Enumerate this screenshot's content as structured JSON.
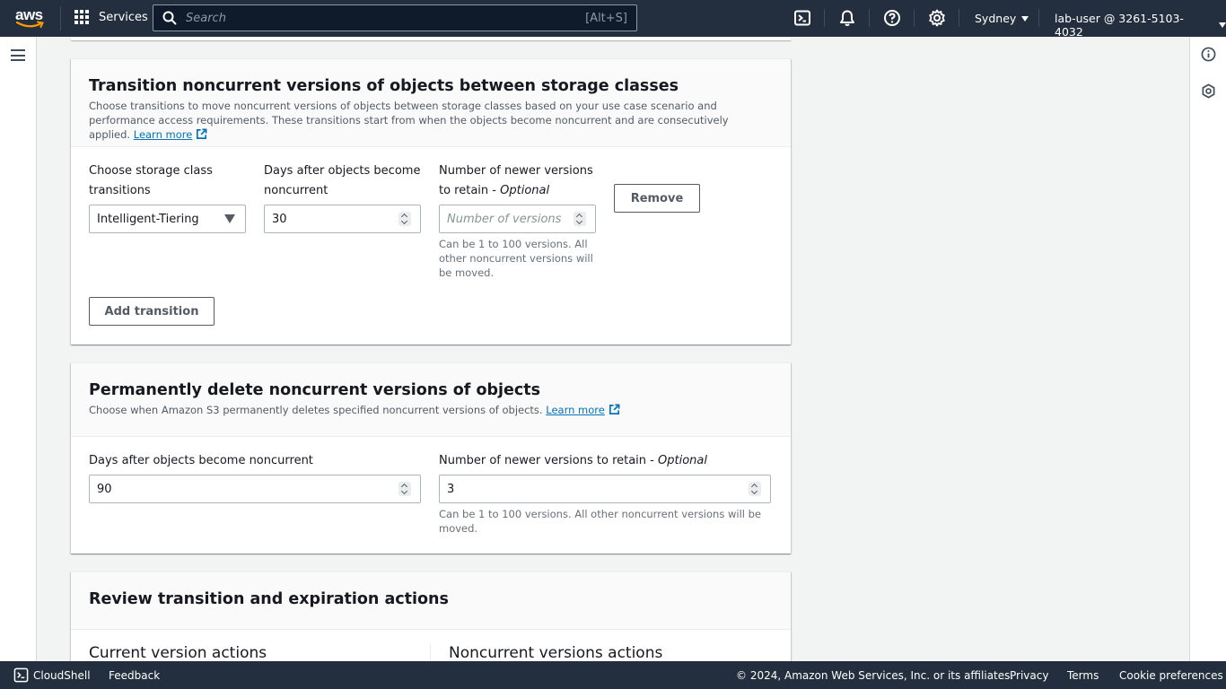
{
  "nav": {
    "logo_text": "aws",
    "services_label": "Services",
    "search_placeholder": "Search",
    "search_shortcut": "[Alt+S]",
    "region": "Sydney",
    "user": "lab-user @ 3261-5103-4032"
  },
  "transition_section": {
    "title": "Transition noncurrent versions of objects between storage classes",
    "description": "Choose transitions to move noncurrent versions of objects between storage classes based on your use case scenario and performance access requirements. These transitions start from when the objects become noncurrent and are consecutively applied.",
    "learn_more": "Learn more",
    "storage_class_label_1": "Choose storage class",
    "storage_class_label_2": "transitions",
    "storage_class_value": "Intelligent-Tiering",
    "days_label_1": "Days after objects become",
    "days_label_2": "noncurrent",
    "days_value": "30",
    "versions_label_1": "Number of newer versions",
    "versions_label_2": "to retain - ",
    "versions_label_optional": "Optional",
    "versions_placeholder": "Number of versions",
    "versions_hint_1": "Can be 1 to 100 versions. All",
    "versions_hint_2": "other noncurrent versions will",
    "versions_hint_3": "be moved.",
    "remove_button": "Remove",
    "add_transition_button": "Add transition"
  },
  "delete_section": {
    "title": "Permanently delete noncurrent versions of objects",
    "description": "Choose when Amazon S3 permanently deletes specified noncurrent versions of objects.",
    "learn_more": "Learn more",
    "days_label": "Days after objects become noncurrent",
    "days_value": "90",
    "versions_label": "Number of newer versions to retain - ",
    "versions_label_optional": "Optional",
    "versions_value": "3",
    "versions_hint_1": "Can be 1 to 100 versions. All other noncurrent versions will be",
    "versions_hint_2": "moved."
  },
  "review_section": {
    "title": "Review transition and expiration actions",
    "current_heading": "Current version actions",
    "noncurrent_heading": "Noncurrent versions actions"
  },
  "footer": {
    "cloudshell": "CloudShell",
    "feedback": "Feedback",
    "copyright": "© 2024, Amazon Web Services, Inc. or its affiliates.",
    "privacy": "Privacy",
    "terms": "Terms",
    "cookie": "Cookie preferences"
  }
}
